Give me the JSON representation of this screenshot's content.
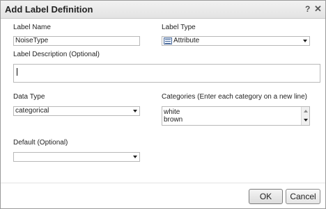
{
  "dialog": {
    "title": "Add Label Definition",
    "help_glyph": "?",
    "close_glyph": "✕"
  },
  "fields": {
    "label_name": {
      "label": "Label Name",
      "value": "NoiseType"
    },
    "label_type": {
      "label": "Label Type",
      "value": "Attribute",
      "icon": "attribute-type-icon"
    },
    "label_description": {
      "label": "Label Description (Optional)",
      "value": ""
    },
    "data_type": {
      "label": "Data Type",
      "value": "categorical"
    },
    "categories": {
      "label": "Categories (Enter each category on a new line)",
      "items": [
        "white",
        "brown"
      ]
    },
    "default": {
      "label": "Default (Optional)",
      "value": ""
    }
  },
  "buttons": {
    "ok": "OK",
    "cancel": "Cancel"
  },
  "colors": {
    "titlebar": "#e8e8e8",
    "border": "#b8b8b8",
    "text": "#222222"
  }
}
